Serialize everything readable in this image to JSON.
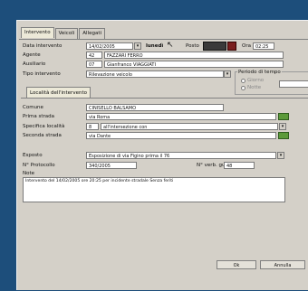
{
  "tabs": [
    "Intervento",
    "Veicoli",
    "Allegati"
  ],
  "fields": {
    "data_intervento_label": "Data intervento",
    "data_intervento_value": "14/02/2005",
    "giorno": "lunedì",
    "posto_label": "Posto",
    "ora_label": "Ora",
    "ora_value": "02:25",
    "agente_label": "Agente",
    "agente_code": "42",
    "agente_name": "FAZZARI FERRO",
    "ausiliario_label": "Ausiliario",
    "ausiliario_code": "07",
    "ausiliario_name": "Gianfranco VIAGGIATI",
    "tipo_label": "Tipo intervento",
    "tipo_value": "Rilevazione veicolo"
  },
  "periodo": {
    "label": "Periodo di tempo",
    "option1": "Giorno",
    "option2": "Notte"
  },
  "subtab": "Località dell'intervento",
  "location": {
    "comune_label": "Comune",
    "comune_value": "CINISELLO BALSAMO",
    "prima_label": "Prima strada",
    "prima_value": "via Roma",
    "specifica_label": "Specifica località",
    "specifica_code": "8",
    "specifica_value": "all'intersezione con",
    "seconda_label": "Seconda strada",
    "seconda_value": "via Dante"
  },
  "esposto": {
    "label": "Esposto",
    "value": "Esposizione di via Figino prima il 76",
    "protocollo_label": "N° Protocollo",
    "protocollo_value": "340/2005",
    "verbale_label": "N° verb. gu",
    "verbale_value": "48",
    "note_label": "Note",
    "note_value": "Intervento del 14/02/2005 ore 20:25 per incidente stradale Senza feriti"
  },
  "buttons": {
    "ok": "Ok",
    "cancel": "Annulla"
  }
}
